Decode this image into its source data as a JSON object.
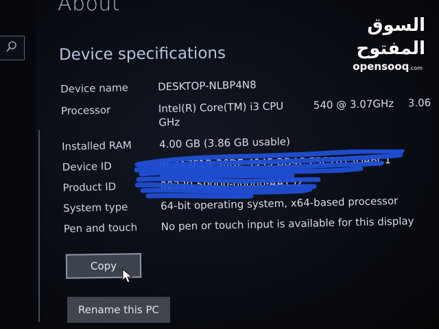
{
  "page": {
    "title": "About",
    "section_title": "Device specifications"
  },
  "specs": {
    "device_name": {
      "label": "Device name",
      "value": "DESKTOP-NLBP4N8"
    },
    "processor": {
      "label": "Processor",
      "value_part1": "Intel(R) Core(TM) i3 CPU",
      "value_part2": "540  @ 3.07GHz",
      "value_part3": "3.06",
      "value_line2": "GHz"
    },
    "installed_ram": {
      "label": "Installed RAM",
      "value": "4.00 GB (3.86 GB usable)"
    },
    "device_id": {
      "label": "Device ID",
      "value": "9E2A7F1B-36DE-4945-BD4C-F5C7B13DABC1"
    },
    "product_id": {
      "label": "Product ID",
      "value": "00330-50000-00000-AA152"
    },
    "system_type": {
      "label": "System type",
      "value": "64-bit operating system, x64-based processor"
    },
    "pen_touch": {
      "label": "Pen and touch",
      "value": "No pen or touch input is available for this display"
    }
  },
  "buttons": {
    "copy": "Copy",
    "rename": "Rename this PC"
  },
  "watermark": {
    "arabic": "السوق المفتوح",
    "latin": "opensooq",
    "suffix": ".com"
  },
  "icons": {
    "search": "search-icon",
    "cursor": "mouse-pointer-icon"
  },
  "colors": {
    "background": "#06080d",
    "text": "#d7dce6",
    "button": "#3d434d",
    "scribble": "#1f4fd6"
  }
}
